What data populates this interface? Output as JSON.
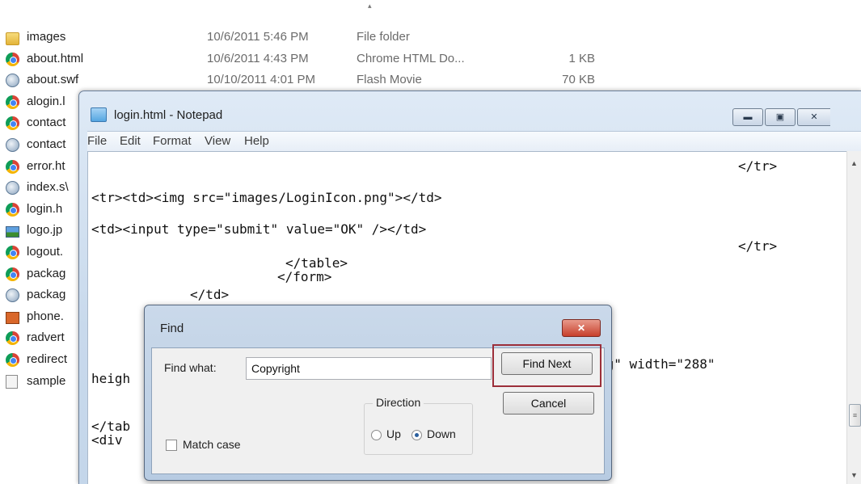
{
  "explorer": {
    "rows": [
      {
        "icon": "folder-icon",
        "name": "images",
        "date": "10/6/2011 5:46 PM",
        "type": "File folder",
        "size": ""
      },
      {
        "icon": "chrome-icon",
        "name": "about.html",
        "date": "10/6/2011 4:43 PM",
        "type": "Chrome HTML Do...",
        "size": "1 KB"
      },
      {
        "icon": "flash-icon",
        "name": "about.swf",
        "date": "10/10/2011 4:01 PM",
        "type": "Flash Movie",
        "size": "70 KB"
      },
      {
        "icon": "chrome-icon",
        "name": "alogin.l",
        "date": "",
        "type": "",
        "size": ""
      },
      {
        "icon": "chrome-icon",
        "name": "contact",
        "date": "",
        "type": "",
        "size": ""
      },
      {
        "icon": "flash-icon",
        "name": "contact",
        "date": "",
        "type": "",
        "size": ""
      },
      {
        "icon": "chrome-icon",
        "name": "error.ht",
        "date": "",
        "type": "",
        "size": ""
      },
      {
        "icon": "flash-icon",
        "name": "index.s\\",
        "date": "",
        "type": "",
        "size": ""
      },
      {
        "icon": "chrome-icon",
        "name": "login.h",
        "date": "",
        "type": "",
        "size": ""
      },
      {
        "icon": "image-icon",
        "name": "logo.jp",
        "date": "",
        "type": "",
        "size": ""
      },
      {
        "icon": "chrome-icon",
        "name": "logout.",
        "date": "",
        "type": "",
        "size": ""
      },
      {
        "icon": "chrome-icon",
        "name": "packag",
        "date": "",
        "type": "",
        "size": ""
      },
      {
        "icon": "flash-icon",
        "name": "packag",
        "date": "",
        "type": "",
        "size": ""
      },
      {
        "icon": "png-icon",
        "name": "phone.",
        "date": "",
        "type": "",
        "size": ""
      },
      {
        "icon": "chrome-icon",
        "name": "radvert",
        "date": "",
        "type": "",
        "size": ""
      },
      {
        "icon": "chrome-icon",
        "name": "redirect",
        "date": "",
        "type": "",
        "size": ""
      },
      {
        "icon": "text-file-icon",
        "name": "sample",
        "date": "",
        "type": "",
        "size": ""
      }
    ]
  },
  "notepad": {
    "title": "login.html - Notepad",
    "menu": [
      "File",
      "Edit",
      "Format",
      "View",
      "Help"
    ],
    "code_lines": [
      "</tr>",
      "<tr><td><img src=\"images/LoginIcon.png\"></td>",
      "<td><input type=\"submit\" value=\"OK\" /></td>",
      "</tr>",
      "</table>",
      "</form>",
      "</td>",
      "og\" width=\"288\"",
      "heigh",
      "</tab",
      "<div"
    ]
  },
  "find_dialog": {
    "title": "Find",
    "find_what_label": "Find what:",
    "find_what_value": "Copyright",
    "find_next_label": "Find Next",
    "cancel_label": "Cancel",
    "direction_label": "Direction",
    "up_label": "Up",
    "down_label": "Down",
    "direction_selected": "Down",
    "match_case_label": "Match case",
    "match_case_checked": false
  }
}
